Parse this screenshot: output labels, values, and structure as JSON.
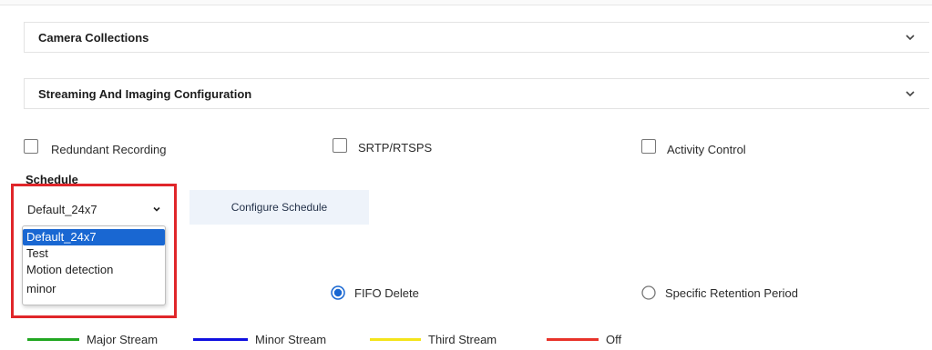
{
  "accordions": [
    {
      "title": "Camera Collections"
    },
    {
      "title": "Streaming And Imaging Configuration"
    }
  ],
  "checkboxes": [
    {
      "label": "Redundant Recording",
      "checked": false
    },
    {
      "label": "SRTP/RTSPS",
      "checked": false
    },
    {
      "label": "Activity Control",
      "checked": false
    }
  ],
  "schedule": {
    "label": "Schedule",
    "selected": "Default_24x7",
    "configure_button": "Configure Schedule",
    "options": [
      "Default_24x7",
      "Test",
      "Motion detection",
      "minor"
    ]
  },
  "storage_mode": {
    "options": [
      {
        "label": "FIFO Delete",
        "selected": true
      },
      {
        "label": "Specific Retention Period",
        "selected": false
      }
    ]
  },
  "legend": [
    {
      "label": "Major Stream",
      "color": "#22a722"
    },
    {
      "label": "Minor Stream",
      "color": "#1010e0"
    },
    {
      "label": "Third Stream",
      "color": "#f4e41a"
    },
    {
      "label": "Off",
      "color": "#e8332a"
    }
  ],
  "colors": {
    "accent": "#1967d2",
    "highlight_frame": "#e0262a"
  },
  "icons": {
    "accordion_chevron": "chevron-down-icon",
    "select_arrow": "caret-down-icon"
  }
}
